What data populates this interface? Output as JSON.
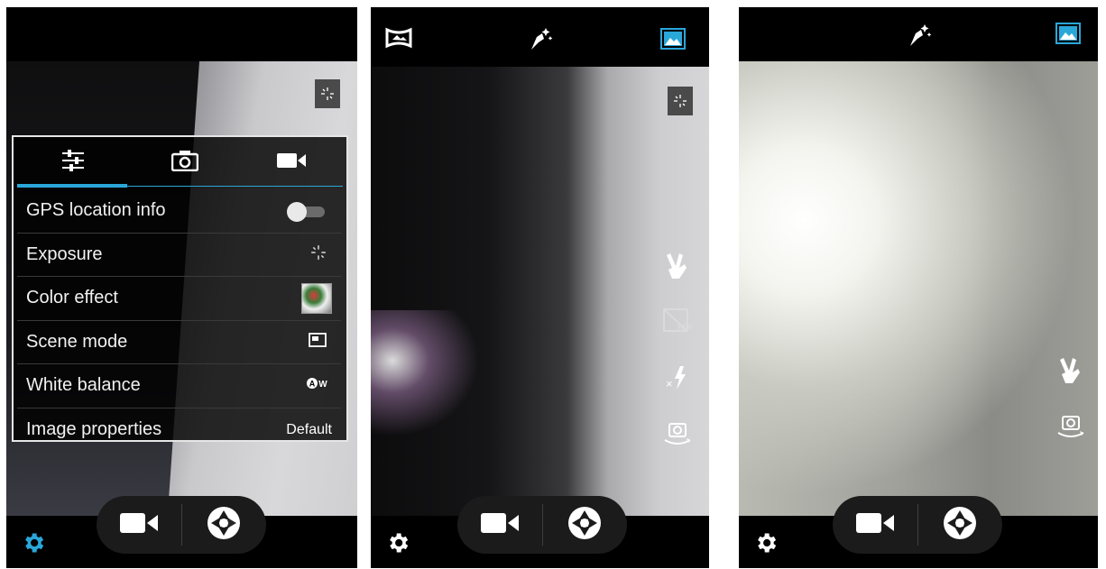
{
  "panel1": {
    "menu": {
      "tabs": [
        "settings-sliders",
        "camera",
        "video"
      ],
      "rows": [
        {
          "label": "GPS location info",
          "value": "",
          "icon": "toggle-off"
        },
        {
          "label": "Exposure",
          "value": "",
          "icon": "exposure-icon"
        },
        {
          "label": "Color effect",
          "value": "",
          "icon": "color-effect-thumb"
        },
        {
          "label": "Scene mode",
          "value": "",
          "icon": "scene-mode-icon"
        },
        {
          "label": "White balance",
          "value": "",
          "icon": "auto-white-balance-icon"
        },
        {
          "label": "Image properties",
          "value": "Default",
          "icon": ""
        }
      ]
    }
  },
  "colors": {
    "accent": "#2aa7d9",
    "gear_active": "#2aa7d9"
  }
}
